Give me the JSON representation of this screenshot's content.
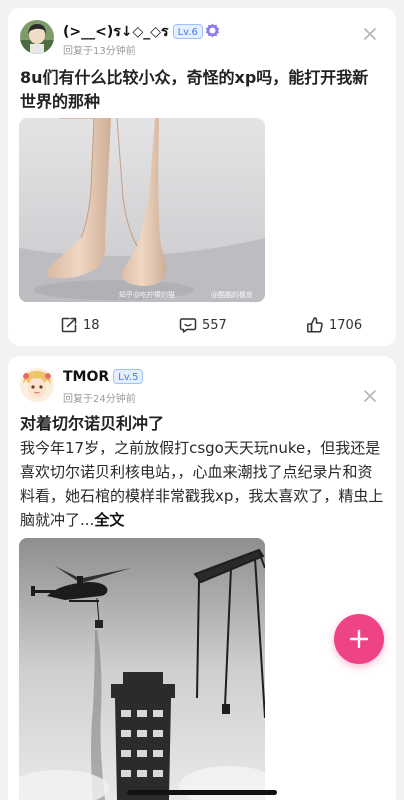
{
  "posts": [
    {
      "user": {
        "name": "(>__<)ร↓◇_◇ร",
        "level": "Lv.6"
      },
      "time": "回复于13分钟前",
      "title": "8u们有什么比较小众，奇怪的xp吗，能打开我新世界的那种",
      "image": {
        "watermark_left": "知乎@吃柠檬的猫",
        "watermark_right": "@酷酷的橡皮"
      },
      "stats": {
        "share": "18",
        "comments": "557",
        "likes": "1706"
      }
    },
    {
      "user": {
        "name": "TMOR",
        "level": "Lv.5"
      },
      "time": "回复于24分钟前",
      "title": "对着切尔诺贝利冲了",
      "body": "我今年17岁，之前放假打csgo天天玩nuke，但我还是喜欢切尔诺贝利核电站，，心血来潮找了点纪录片和资料看，她石棺的模样非常戳我xp，我太喜欢了，精虫上脑就冲了...",
      "more_label": "全文"
    }
  ],
  "colors": {
    "accent": "#ee4486",
    "level_badge": "#3e7bff",
    "page_bg": "#f2f2f4"
  },
  "icons": [
    "close-icon",
    "share-icon",
    "comment-icon",
    "like-icon",
    "plus-icon",
    "verified-badge-icon"
  ]
}
